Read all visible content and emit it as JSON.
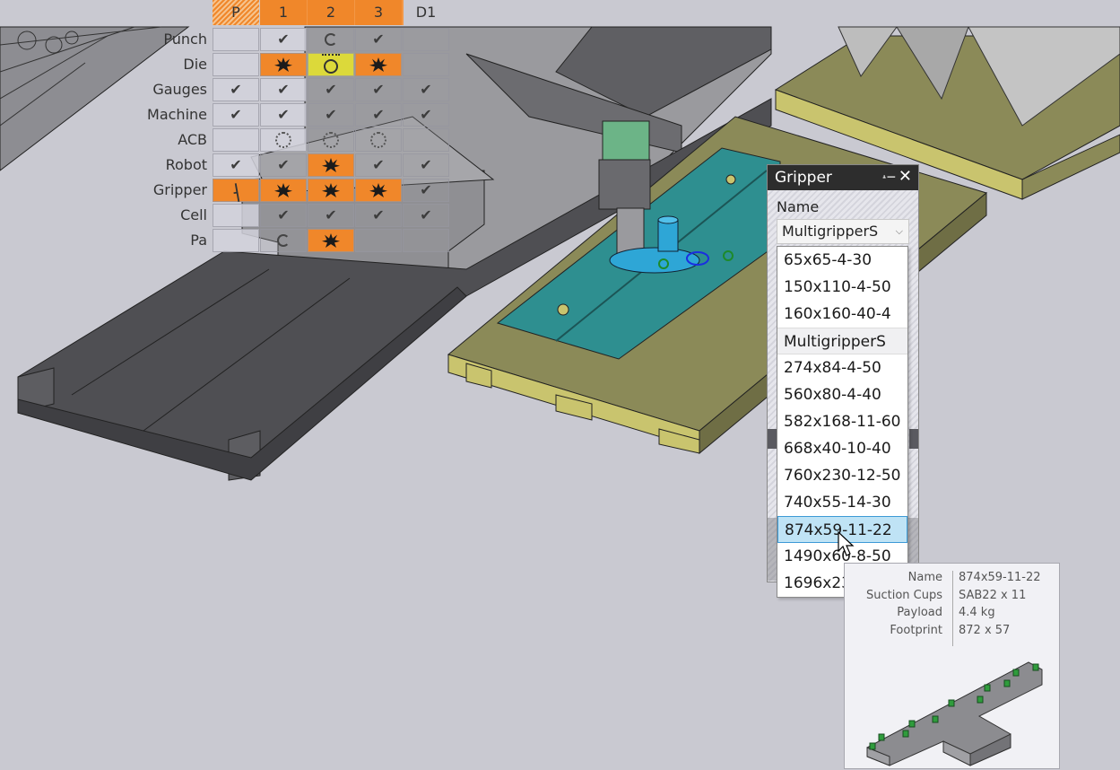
{
  "matrix": {
    "columns": [
      {
        "label": "P",
        "style": "hatch"
      },
      {
        "label": "1",
        "style": "orange"
      },
      {
        "label": "2",
        "style": "orange"
      },
      {
        "label": "3",
        "style": "orange"
      },
      {
        "label": "D1",
        "style": "plain"
      }
    ],
    "rows": [
      {
        "label": "Punch",
        "cells": [
          "empty",
          "check",
          "partial-circle",
          "check",
          "empty"
        ]
      },
      {
        "label": "Die",
        "cells": [
          "empty",
          "burst",
          "die-yellow",
          "burst",
          "empty"
        ]
      },
      {
        "label": "Gauges",
        "cells": [
          "check",
          "check",
          "check",
          "check",
          "check"
        ]
      },
      {
        "label": "Machine",
        "cells": [
          "check",
          "check",
          "check",
          "check",
          "check"
        ]
      },
      {
        "label": "ACB",
        "cells": [
          "empty",
          "dotted-circle",
          "dotted-circle",
          "dotted-circle",
          "empty"
        ]
      },
      {
        "label": "Robot",
        "cells": [
          "check",
          "check",
          "burst",
          "check",
          "check"
        ]
      },
      {
        "label": "Gripper",
        "cells": [
          "gauge",
          "burst",
          "burst",
          "burst",
          "check"
        ]
      },
      {
        "label": "Cell",
        "cells": [
          "empty",
          "check",
          "check",
          "check",
          "check"
        ]
      },
      {
        "label": "Pa",
        "cells": [
          "empty",
          "partial-circle",
          "burst",
          "empty",
          "empty"
        ]
      }
    ],
    "colors": {
      "error": "#f0872a",
      "warning": "#dcd93a"
    }
  },
  "gripper_panel": {
    "title": "Gripper",
    "pin_icon": "pin-icon",
    "close_icon": "close-icon",
    "name_label": "Name",
    "selected_value": "MultigripperS",
    "options": [
      {
        "label": "65x65-4-30",
        "type": "item"
      },
      {
        "label": "150x110-4-50",
        "type": "item"
      },
      {
        "label": "160x160-40-4",
        "type": "item"
      },
      {
        "label": "MultigripperS",
        "type": "group"
      },
      {
        "label": "274x84-4-50",
        "type": "item"
      },
      {
        "label": "560x80-4-40",
        "type": "item"
      },
      {
        "label": "582x168-11-60",
        "type": "item"
      },
      {
        "label": "668x40-10-40",
        "type": "item"
      },
      {
        "label": "760x230-12-50",
        "type": "item"
      },
      {
        "label": "740x55-14-30",
        "type": "item"
      },
      {
        "label": "874x59-11-22",
        "type": "selected"
      },
      {
        "label": "1490x60-8-50",
        "type": "item"
      },
      {
        "label": "1696x23",
        "type": "item"
      }
    ]
  },
  "tooltip": {
    "rows": [
      {
        "key": "Name",
        "value": "874x59-11-22"
      },
      {
        "key": "Suction Cups",
        "value": "SAB22 x 11"
      },
      {
        "key": "Payload",
        "value": "4.4 kg"
      },
      {
        "key": "Footprint",
        "value": "872 x 57"
      }
    ]
  }
}
